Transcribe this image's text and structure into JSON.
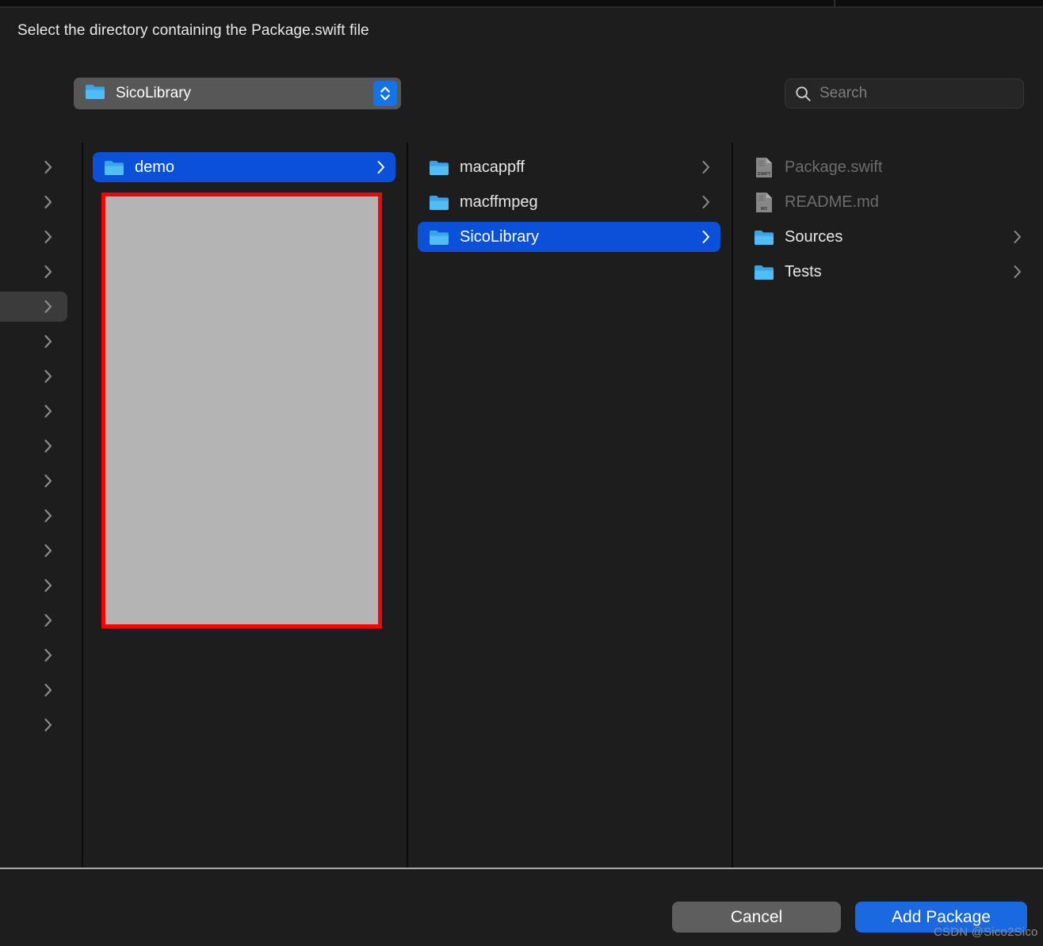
{
  "dialog": {
    "title": "Select the directory containing the Package.swift file"
  },
  "path_popup": {
    "icon": "folder-icon",
    "value": "SicoLibrary",
    "stepper_icon": "up-down-chevron-icon"
  },
  "search": {
    "icon": "search-icon",
    "value": "",
    "placeholder": "Search"
  },
  "browser": {
    "columns": [
      {
        "name": "column-0-clipped",
        "rows": [
          {
            "label": "",
            "icon": "chevron-right-icon",
            "selected": false,
            "highlighted": false
          },
          {
            "label": "",
            "icon": "chevron-right-icon",
            "selected": false,
            "highlighted": false
          },
          {
            "label": "",
            "icon": "chevron-right-icon",
            "selected": false,
            "highlighted": false
          },
          {
            "label": "",
            "icon": "chevron-right-icon",
            "selected": false,
            "highlighted": false
          },
          {
            "label": "",
            "icon": "chevron-right-icon",
            "selected": false,
            "highlighted": true
          },
          {
            "label": "",
            "icon": "chevron-right-icon",
            "selected": false,
            "highlighted": false
          },
          {
            "label": "",
            "icon": "chevron-right-icon",
            "selected": false,
            "highlighted": false
          },
          {
            "label": "",
            "icon": "chevron-right-icon",
            "selected": false,
            "highlighted": false
          },
          {
            "label": "",
            "icon": "chevron-right-icon",
            "selected": false,
            "highlighted": false
          },
          {
            "label": "",
            "icon": "chevron-right-icon",
            "selected": false,
            "highlighted": false
          },
          {
            "label": "",
            "icon": "chevron-right-icon",
            "selected": false,
            "highlighted": false
          },
          {
            "label": "",
            "icon": "chevron-right-icon",
            "selected": false,
            "highlighted": false
          },
          {
            "label": "",
            "icon": "chevron-right-icon",
            "selected": false,
            "highlighted": false
          },
          {
            "label": "",
            "icon": "chevron-right-icon",
            "selected": false,
            "highlighted": false
          },
          {
            "label": "",
            "icon": "chevron-right-icon",
            "selected": false,
            "highlighted": false
          },
          {
            "label": "",
            "icon": "chevron-right-icon",
            "selected": false,
            "highlighted": false
          },
          {
            "label": "",
            "icon": "chevron-right-icon",
            "selected": false,
            "highlighted": false
          }
        ]
      },
      {
        "name": "column-1",
        "rows": [
          {
            "label": "demo",
            "icon": "folder-icon",
            "kind": "folder",
            "selected": true,
            "has_chevron": true,
            "dimmed": false
          }
        ]
      },
      {
        "name": "column-2",
        "rows": [
          {
            "label": "macappff",
            "icon": "folder-icon",
            "kind": "folder",
            "selected": false,
            "has_chevron": true,
            "dimmed": false
          },
          {
            "label": "macffmpeg",
            "icon": "folder-icon",
            "kind": "folder",
            "selected": false,
            "has_chevron": true,
            "dimmed": false
          },
          {
            "label": "SicoLibrary",
            "icon": "folder-icon",
            "kind": "folder",
            "selected": true,
            "has_chevron": true,
            "dimmed": false
          }
        ]
      },
      {
        "name": "column-3",
        "rows": [
          {
            "label": "Package.swift",
            "icon": "swift-document-icon",
            "kind": "file",
            "badge": "SWIFT",
            "selected": false,
            "has_chevron": false,
            "dimmed": true
          },
          {
            "label": "README.md",
            "icon": "md-document-icon",
            "kind": "file",
            "badge": "MD",
            "selected": false,
            "has_chevron": false,
            "dimmed": true
          },
          {
            "label": "Sources",
            "icon": "folder-icon",
            "kind": "folder",
            "selected": false,
            "has_chevron": true,
            "dimmed": false
          },
          {
            "label": "Tests",
            "icon": "folder-icon",
            "kind": "folder",
            "selected": false,
            "has_chevron": true,
            "dimmed": false
          }
        ]
      }
    ]
  },
  "annotation": {
    "name": "red-highlight-rectangle",
    "border_color": "#fe0000",
    "fill_color": "#b4b4b4"
  },
  "footer": {
    "cancel_label": "Cancel",
    "add_label": "Add Package",
    "watermark": "CSDN @Sico2Sico"
  },
  "colors": {
    "selection_blue": "#0a50d8",
    "accent_blue": "#1a69e0",
    "background": "#1d1d1d"
  }
}
